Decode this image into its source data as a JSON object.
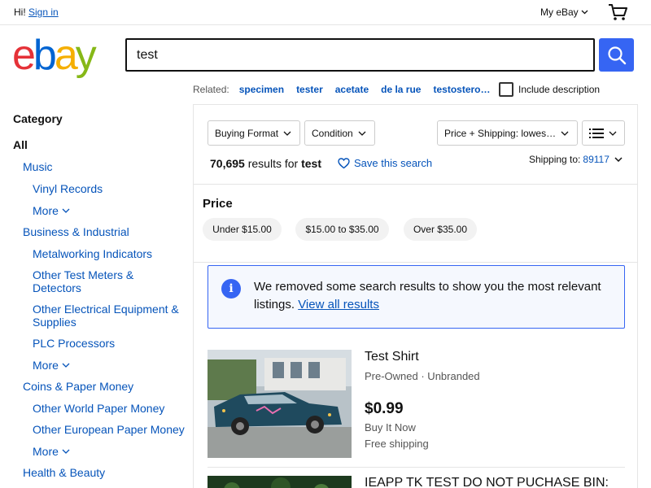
{
  "header": {
    "greeting": "Hi!",
    "sign_in": "Sign in",
    "my_ebay": "My eBay"
  },
  "logo": {
    "e": "e",
    "b": "b",
    "a": "a",
    "y": "y"
  },
  "search": {
    "value": "test"
  },
  "related": {
    "label": "Related:",
    "terms": [
      "specimen",
      "tester",
      "acetate",
      "de la rue",
      "testostero…"
    ],
    "include_description": "Include description"
  },
  "sidebar": {
    "title": "Category",
    "items": [
      "All",
      "Music",
      "Vinyl Records",
      "More",
      "Business & Industrial",
      "Metalworking Indicators",
      "Other Test Meters &",
      "Detectors",
      "Other Electrical Equipment &",
      "Supplies",
      "PLC Processors",
      "More",
      "Coins & Paper Money",
      "Other World Paper Money",
      "Other European Paper Money",
      "More",
      "Health & Beauty"
    ]
  },
  "filters": {
    "buying_format": "Buying Format",
    "condition": "Condition",
    "sort": "Price + Shipping: lowes…"
  },
  "results": {
    "count": "70,695",
    "results_for": "results for",
    "query": "test",
    "save_search": "Save this search",
    "shipping_to": "Shipping to:",
    "zip": "89117"
  },
  "price_filter": {
    "title": "Price",
    "options": [
      "Under $15.00",
      "$15.00 to $35.00",
      "Over $35.00"
    ]
  },
  "notice": {
    "icon": "i",
    "text": "We removed some search results to show you the most relevant listings.",
    "link": "View all results"
  },
  "items": [
    {
      "title": "Test Shirt",
      "subtitle": "Pre-Owned · Unbranded",
      "price": "$0.99",
      "format": "Buy It Now",
      "shipping": "Free shipping"
    },
    {
      "title": "IEAPP TK TEST DO NOT PUCHASE BIN:"
    }
  ],
  "colors": {
    "brand_blue": "#3665f3",
    "link_blue": "#0654ba",
    "logo_red": "#e53238",
    "logo_blue": "#0064d2",
    "logo_yellow": "#f5af02",
    "logo_green": "#86b817"
  }
}
